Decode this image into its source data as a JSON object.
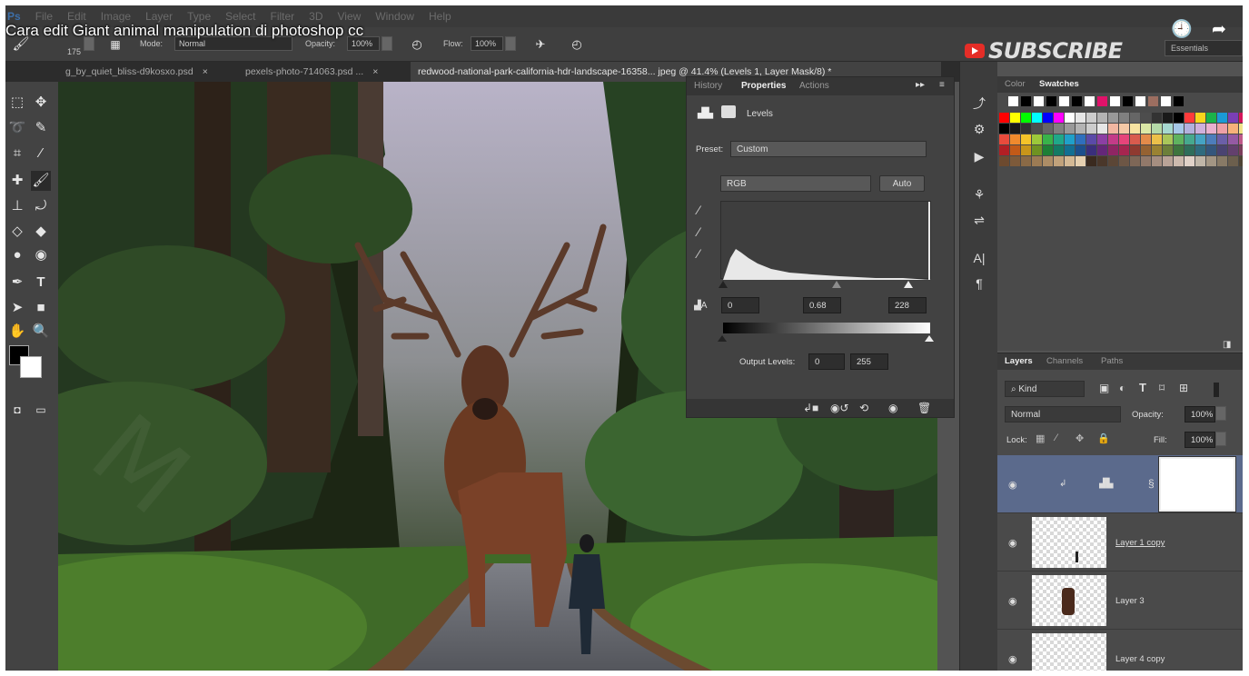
{
  "video": {
    "title": "Cara edit Giant animal manipulation di photoshop cc",
    "subscribe_label": "SUBSCRIBE",
    "watch_later_icon": "clock-icon",
    "share_icon": "share-arrow-icon"
  },
  "app": {
    "logo_letters": "Ps",
    "menu": [
      "File",
      "Edit",
      "Image",
      "Layer",
      "Type",
      "Select",
      "Filter",
      "3D",
      "View",
      "Window",
      "Help"
    ],
    "workspace": "Essentials"
  },
  "options_bar": {
    "brush_size": "175",
    "mode_label": "Mode:",
    "mode_value": "Normal",
    "opacity_label": "Opacity:",
    "opacity_value": "100%",
    "flow_label": "Flow:",
    "flow_value": "100%"
  },
  "tabs": [
    {
      "label": "g_by_quiet_bliss-d9kosxo.psd",
      "close": "×"
    },
    {
      "label": "pexels-photo-714063.psd ...",
      "close": "×"
    },
    {
      "label": "redwood-national-park-california-hdr-landscape-16358... jpeg @ 41.4% (Levels 1, Layer Mask/8) *",
      "active": true
    }
  ],
  "properties": {
    "tabs": [
      "History",
      "Properties",
      "Actions"
    ],
    "active_tab": "Properties",
    "panel_title": "Levels",
    "preset_label": "Preset:",
    "preset_value": "Custom",
    "channel_value": "RGB",
    "auto_label": "Auto",
    "input_black": "0",
    "input_gamma": "0.68",
    "input_white": "228",
    "output_label": "Output Levels:",
    "output_black": "0",
    "output_white": "255"
  },
  "swatches": {
    "tabs": [
      "Color",
      "Swatches"
    ],
    "active_tab": "Swatches"
  },
  "layers_panel": {
    "tabs": [
      "Layers",
      "Channels",
      "Paths"
    ],
    "active_tab": "Layers",
    "kind_label": "Kind",
    "blend_mode": "Normal",
    "opacity_label": "Opacity:",
    "opacity_value": "100%",
    "lock_label": "Lock:",
    "fill_label": "Fill:",
    "fill_value": "100%",
    "layers": [
      {
        "name": "",
        "type": "levels-adjustment",
        "selected": true
      },
      {
        "name": "Layer 1 copy"
      },
      {
        "name": "Layer 3"
      },
      {
        "name": "Layer 4 copy"
      }
    ]
  },
  "colors": {
    "ui_dark": "#3a3a3a",
    "ui_mid": "#535353",
    "selected_layer": "#5b6a8c",
    "subscribe_red": "#e52d27"
  }
}
